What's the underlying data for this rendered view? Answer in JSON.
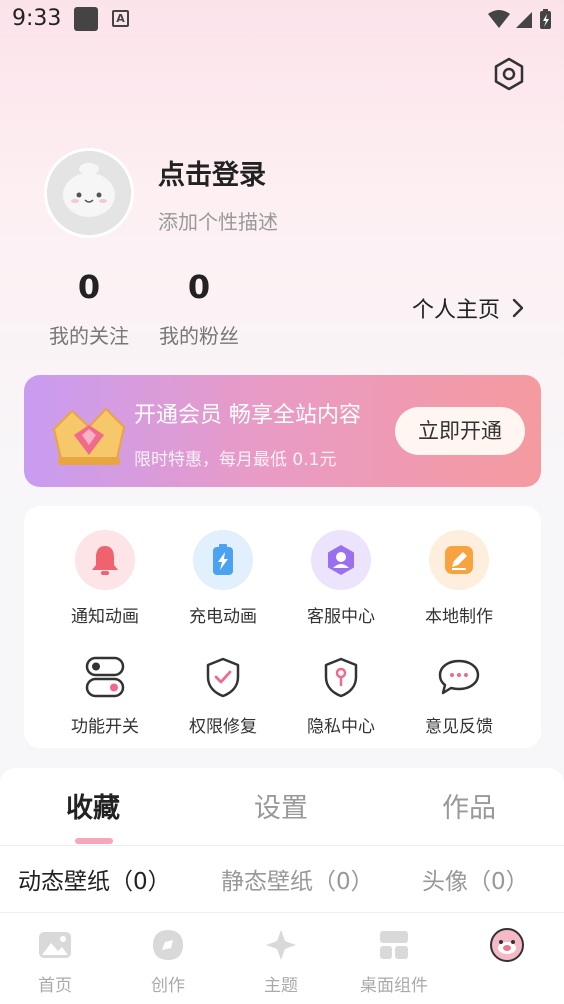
{
  "status": {
    "time": "9:33"
  },
  "profile": {
    "login_text": "点击登录",
    "description": "添加个性描述",
    "following_count": "0",
    "following_label": "我的关注",
    "fans_count": "0",
    "fans_label": "我的粉丝",
    "homepage_label": "个人主页"
  },
  "vip": {
    "title": "开通会员 畅享全站内容",
    "subtitle": "限时特惠，每月最低 0.1元",
    "button": "立即开通"
  },
  "grid": {
    "row1": [
      {
        "label": "通知动画",
        "icon": "bell-icon",
        "bg": "#fde4e6",
        "color": "#f0626e"
      },
      {
        "label": "充电动画",
        "icon": "battery-charge-icon",
        "bg": "#e2f0fd",
        "color": "#4aa2f0"
      },
      {
        "label": "客服中心",
        "icon": "customer-service-icon",
        "bg": "#ece4fc",
        "color": "#9a6ff0"
      },
      {
        "label": "本地制作",
        "icon": "pen-edit-icon",
        "bg": "#fdeedd",
        "color": "#f7a340"
      }
    ],
    "row2": [
      {
        "label": "功能开关",
        "icon": "toggle-switch-icon"
      },
      {
        "label": "权限修复",
        "icon": "shield-check-icon"
      },
      {
        "label": "隐私中心",
        "icon": "shield-lock-icon"
      },
      {
        "label": "意见反馈",
        "icon": "chat-bubble-icon"
      }
    ]
  },
  "tabs": [
    "收藏",
    "设置",
    "作品"
  ],
  "subtabs": [
    "动态壁纸（0）",
    "静态壁纸（0）",
    "头像（0）"
  ],
  "nav": [
    {
      "label": "首页",
      "icon": "image-icon"
    },
    {
      "label": "创作",
      "icon": "create-icon"
    },
    {
      "label": "主题",
      "icon": "theme-star-icon"
    },
    {
      "label": "桌面组件",
      "icon": "widget-icon"
    },
    {
      "label": "",
      "icon": "mine-avatar-icon"
    }
  ],
  "colors": {
    "accent": "#f6a7bb",
    "vip_start": "#c89cf2",
    "vip_end": "#f59a9f"
  }
}
